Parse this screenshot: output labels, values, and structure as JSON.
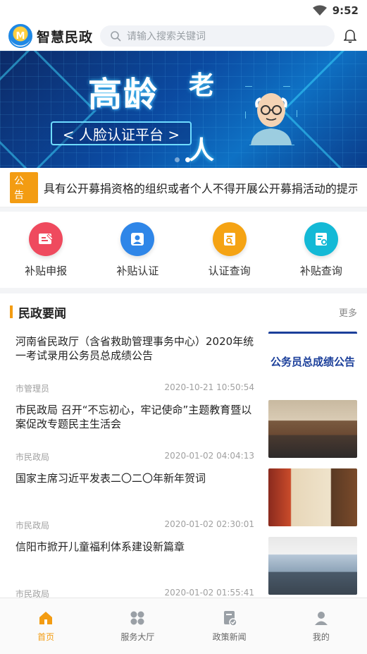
{
  "status_bar": {
    "time": "9:52"
  },
  "header": {
    "app_name": "智慧民政",
    "search_placeholder": "请输入搜索关键词"
  },
  "banner": {
    "title_main": "高龄",
    "title_side_top": "老",
    "title_side_bottom": "人",
    "subtitle": "< 人脸认证平台 >"
  },
  "notice": {
    "tag": "公告",
    "text": "具有公开募捐资格的组织或者个人不得开展公开募捐活动的提示"
  },
  "quick_actions": [
    {
      "label": "补贴申报",
      "color": "#ef4a5e",
      "icon": "form-icon"
    },
    {
      "label": "补贴认证",
      "color": "#2f86e8",
      "icon": "face-scan-icon"
    },
    {
      "label": "认证查询",
      "color": "#f5a313",
      "icon": "search-doc-icon"
    },
    {
      "label": "补贴查询",
      "color": "#14b9d6",
      "icon": "list-search-icon"
    }
  ],
  "news": {
    "section_title": "民政要闻",
    "more_label": "更多",
    "items": [
      {
        "title": "河南省民政厅（含省救助管理事务中心）2020年统一考试录用公务员总成绩公告",
        "source": "市管理员",
        "time": "2020-10-21 10:50:54",
        "thumb_text": "公务员总成绩公告"
      },
      {
        "title": "市民政局 召开“不忘初心，牢记使命”主题教育暨以案促改专题民主生活会",
        "source": "市民政局",
        "time": "2020-01-02 04:04:13"
      },
      {
        "title": "国家主席习近平发表二〇二〇年新年贺词",
        "source": "市民政局",
        "time": "2020-01-02 02:30:01"
      },
      {
        "title": "信阳市掀开儿童福利体系建设新篇章",
        "source": "市民政局",
        "time": "2020-01-02 01:55:41"
      }
    ]
  },
  "tabbar": [
    {
      "label": "首页",
      "active": true
    },
    {
      "label": "服务大厅",
      "active": false
    },
    {
      "label": "政策新闻",
      "active": false
    },
    {
      "label": "我的",
      "active": false
    }
  ],
  "colors": {
    "accent": "#f39c12"
  }
}
